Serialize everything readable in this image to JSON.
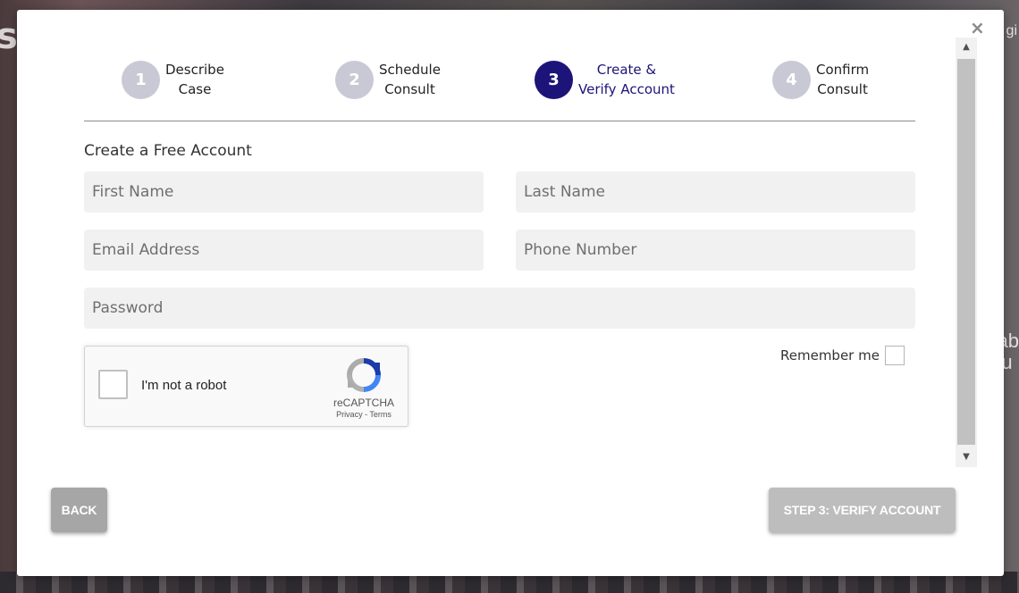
{
  "background": {
    "left_text": "s",
    "right_text_top": "gi",
    "right_text_mid": [
      "ab",
      "lu"
    ]
  },
  "modal": {
    "close_label": "×"
  },
  "steps": [
    {
      "number": "1",
      "line1": "Describe",
      "line2": "Case",
      "state": "inactive"
    },
    {
      "number": "2",
      "line1": "Schedule",
      "line2": "Consult",
      "state": "inactive"
    },
    {
      "number": "3",
      "line1": "Create &",
      "line2": "Verify Account",
      "state": "active"
    },
    {
      "number": "4",
      "line1": "Confirm",
      "line2": "Consult",
      "state": "inactive"
    }
  ],
  "form": {
    "title": "Create a Free Account",
    "first_name": {
      "placeholder": "First Name",
      "value": ""
    },
    "last_name": {
      "placeholder": "Last Name",
      "value": ""
    },
    "email": {
      "placeholder": "Email Address",
      "value": ""
    },
    "phone": {
      "placeholder": "Phone Number",
      "value": ""
    },
    "password": {
      "placeholder": "Password",
      "value": ""
    },
    "remember_label": "Remember me",
    "remember_checked": false
  },
  "recaptcha": {
    "label": "I'm not a robot",
    "brand": "reCAPTCHA",
    "privacy": "Privacy",
    "separator": " - ",
    "terms": "Terms"
  },
  "buttons": {
    "back": "BACK",
    "next": "STEP 3: VERIFY ACCOUNT"
  },
  "colors": {
    "active_step": "#1c1479",
    "inactive_step": "#c9c9d6",
    "field_bg": "#f1f1f1",
    "back_button": "#a6a6a6",
    "next_button": "#bdbdbd"
  },
  "icons": {
    "close": "close-icon",
    "recaptcha": "recaptcha-logo-icon",
    "scroll_up": "triangle-up-icon",
    "scroll_down": "triangle-down-icon"
  }
}
